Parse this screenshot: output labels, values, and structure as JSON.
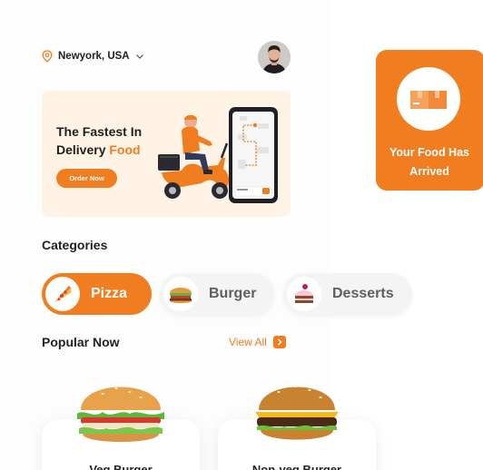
{
  "header": {
    "location": "Newyork, USA"
  },
  "banner": {
    "title_line1": "The Fastest In",
    "title_line2": "Delivery",
    "title_accent": "Food",
    "order_button": "Order Now"
  },
  "categories": {
    "title": "Categories",
    "items": [
      {
        "label": "Pizza",
        "icon": "pizza-icon",
        "active": true
      },
      {
        "label": "Burger",
        "icon": "burger-icon",
        "active": false
      },
      {
        "label": "Desserts",
        "icon": "cake-icon",
        "active": false
      }
    ]
  },
  "popular": {
    "title": "Popular Now",
    "view_all": "View All",
    "items": [
      {
        "name": "Veg Burger"
      },
      {
        "name": "Non-veg Burger"
      }
    ]
  },
  "notification": {
    "line1": "Your Food Has",
    "line2": "Arrived"
  },
  "colors": {
    "accent": "#f07d1f",
    "banner_bg": "#fff3e6"
  }
}
